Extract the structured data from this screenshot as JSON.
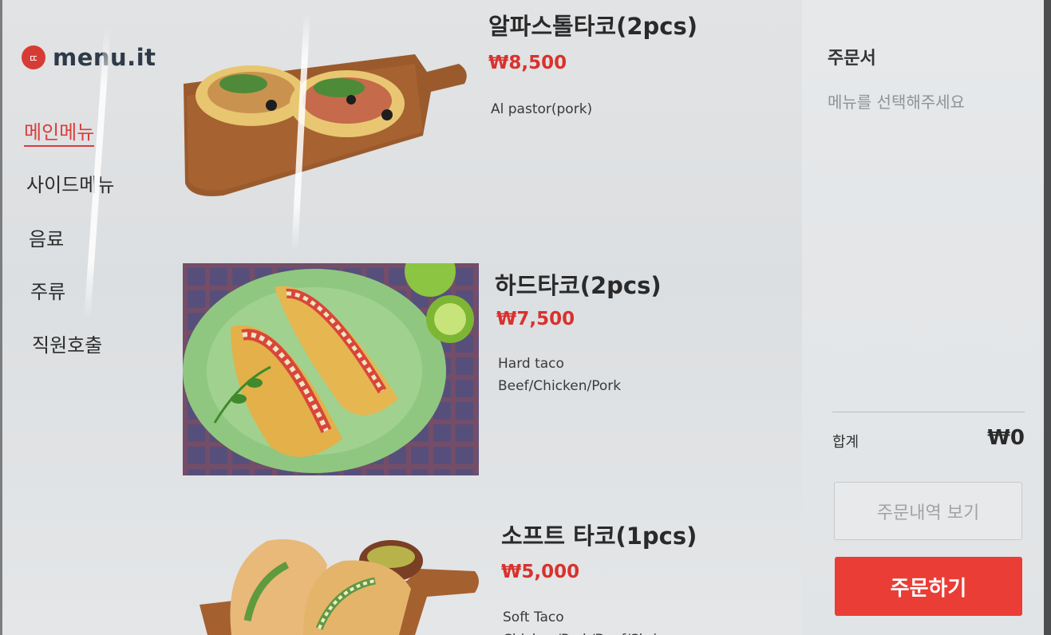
{
  "logo": {
    "mark": "ㄸ",
    "text": "menu.it"
  },
  "nav": [
    {
      "label": "메인메뉴",
      "active": true
    },
    {
      "label": "사이드메뉴",
      "active": false
    },
    {
      "label": "음료",
      "active": false
    },
    {
      "label": "주류",
      "active": false
    },
    {
      "label": "직원호출",
      "active": false
    }
  ],
  "menu_items": [
    {
      "name": "알파스톨타코(2pcs)",
      "price": "₩8,500",
      "desc_line1": "Al pastor(pork)",
      "desc_line2": ""
    },
    {
      "name": "하드타코(2pcs)",
      "price": "₩7,500",
      "desc_line1": "Hard taco",
      "desc_line2": "Beef/Chicken/Pork"
    },
    {
      "name": "소프트 타코(1pcs)",
      "price": "₩5,000",
      "desc_line1": "Soft Taco",
      "desc_line2": "Chicken/Pork/Beef/Shrimp"
    }
  ],
  "order": {
    "title": "주문서",
    "empty_message": "메뉴를 선택해주세요",
    "total_label": "합계",
    "total_value": "₩0",
    "history_button": "주문내역 보기",
    "order_button": "주문하기"
  },
  "colors": {
    "accent": "#ea3d35",
    "price": "#d8322e",
    "nav_active": "#d83e3a"
  }
}
